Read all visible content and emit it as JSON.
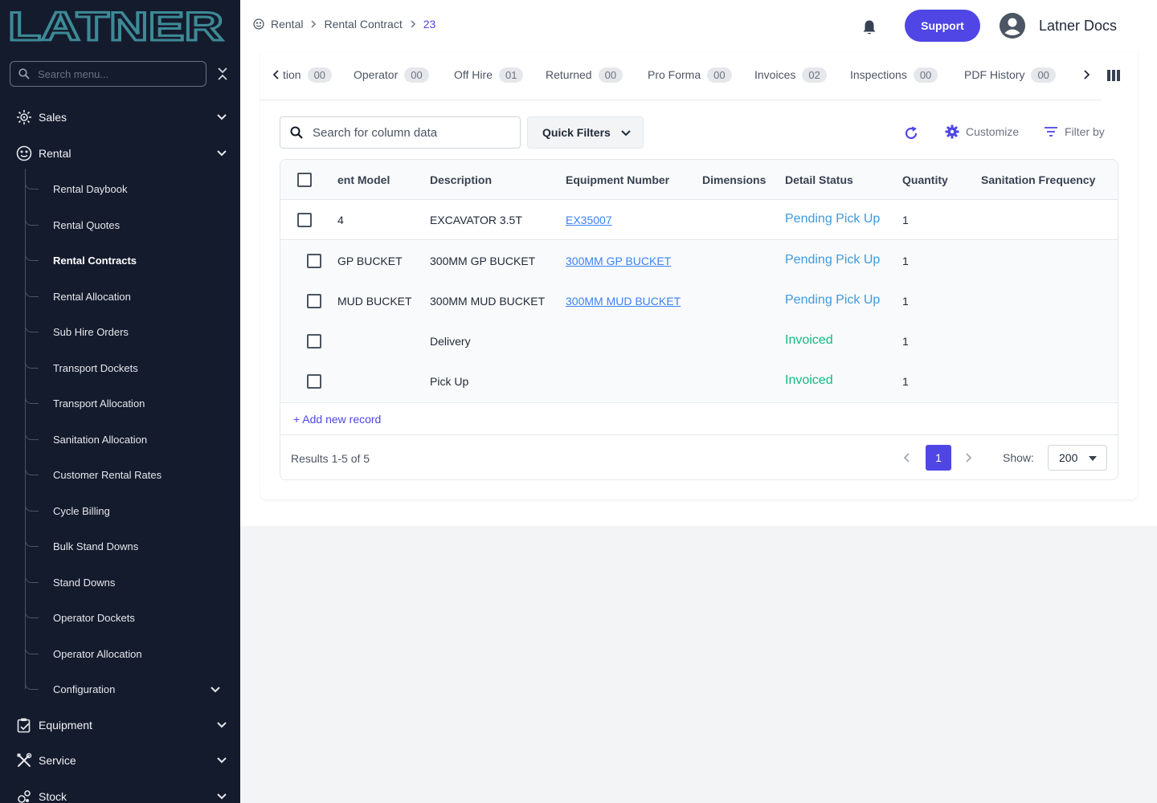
{
  "app": {
    "brand": "LATNER"
  },
  "sidebar": {
    "search_placeholder": "Search menu...",
    "sections": [
      {
        "label": "Sales",
        "icon": "sales-icon"
      },
      {
        "label": "Rental",
        "icon": "rental-icon"
      },
      {
        "label": "Equipment",
        "icon": "equipment-icon"
      },
      {
        "label": "Service",
        "icon": "service-icon"
      },
      {
        "label": "Stock",
        "icon": "stock-icon"
      }
    ],
    "rental_items": [
      {
        "label": "Rental Daybook"
      },
      {
        "label": "Rental Quotes"
      },
      {
        "label": "Rental Contracts",
        "active": true
      },
      {
        "label": "Rental Allocation"
      },
      {
        "label": "Sub Hire Orders"
      },
      {
        "label": "Transport Dockets"
      },
      {
        "label": "Transport Allocation"
      },
      {
        "label": "Sanitation Allocation"
      },
      {
        "label": "Customer Rental Rates"
      },
      {
        "label": "Cycle Billing"
      },
      {
        "label": "Bulk Stand Downs"
      },
      {
        "label": "Stand Downs"
      },
      {
        "label": "Operator Dockets"
      },
      {
        "label": "Operator Allocation"
      },
      {
        "label": "Configuration"
      }
    ]
  },
  "header": {
    "breadcrumb": [
      "Rental",
      "Rental Contract",
      "23"
    ],
    "support_label": "Support",
    "user_name": "Latner Docs"
  },
  "tabs": [
    {
      "label": "tion",
      "count": "00"
    },
    {
      "label": "Operator",
      "count": "00"
    },
    {
      "label": "Off Hire",
      "count": "01"
    },
    {
      "label": "Returned",
      "count": "00"
    },
    {
      "label": "Pro Forma",
      "count": "00"
    },
    {
      "label": "Invoices",
      "count": "02"
    },
    {
      "label": "Inspections",
      "count": "00"
    },
    {
      "label": "PDF History",
      "count": "00"
    }
  ],
  "toolbar": {
    "search_placeholder": "Search for column data",
    "quick_filters_label": "Quick Filters",
    "customize_label": "Customize",
    "filter_by_label": "Filter by"
  },
  "table": {
    "columns": [
      "ent Model",
      "Description",
      "Equipment Number",
      "Dimensions",
      "Detail Status",
      "Quantity",
      "Sanitation Frequency"
    ],
    "rows": [
      {
        "model": "4",
        "description": "EXCAVATOR 3.5T",
        "equipment_number": "EX35007",
        "dimensions": "",
        "status": "Pending Pick Up",
        "quantity": "1"
      },
      {
        "model": "GP BUCKET",
        "description": "300MM GP BUCKET",
        "equipment_number": "300MM GP BUCKET",
        "dimensions": "",
        "status": "Pending Pick Up",
        "quantity": "1"
      },
      {
        "model": "MUD BUCKET",
        "description": "300MM MUD BUCKET",
        "equipment_number": "300MM MUD BUCKET",
        "dimensions": "",
        "status": "Pending Pick Up",
        "quantity": "1"
      },
      {
        "model": "",
        "description": "Delivery",
        "equipment_number": "",
        "dimensions": "",
        "status": "Invoiced",
        "quantity": "1"
      },
      {
        "model": "",
        "description": "Pick Up",
        "equipment_number": "",
        "dimensions": "",
        "status": "Invoiced",
        "quantity": "1"
      }
    ],
    "add_record_label": "+ Add new record"
  },
  "pagination": {
    "results_text": "Results 1-5 of 5",
    "current_page": "1",
    "show_label": "Show:",
    "page_size": "200"
  },
  "colors": {
    "sidebar_bg": "#141b2d",
    "accent": "#4f46e5",
    "pending": "#3b9be0",
    "invoiced": "#10b981",
    "logo_teal": "#3d8a96"
  }
}
